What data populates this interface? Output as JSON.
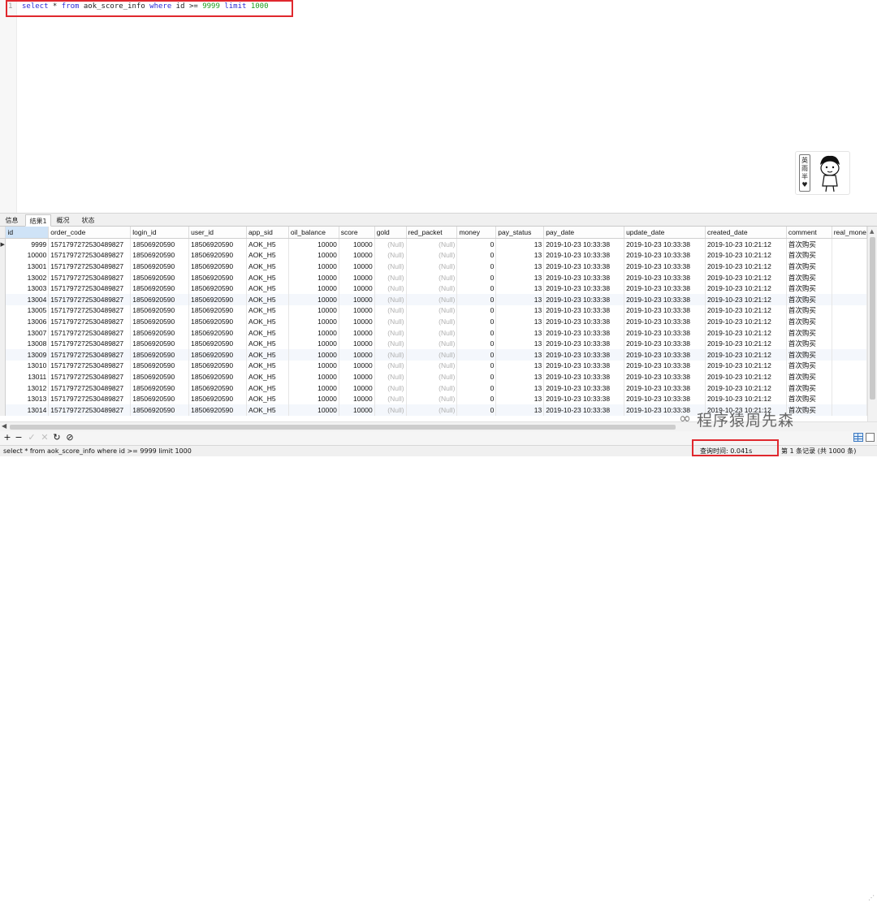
{
  "editor": {
    "line_number": "1",
    "sql": {
      "t1": "select",
      "t2": " * ",
      "t3": "from",
      "t4": " aok_score_info ",
      "t5": "where",
      "t6": " id >= ",
      "t7": "9999",
      "t8": " ",
      "t9": "limit",
      "t10": " ",
      "t11": "1000"
    }
  },
  "avatar": {
    "tag": [
      "英",
      "雨",
      "半"
    ]
  },
  "tabs": [
    {
      "label": "信息"
    },
    {
      "label": "结果1"
    },
    {
      "label": "概况"
    },
    {
      "label": "状态"
    }
  ],
  "active_tab": 1,
  "grid": {
    "columns": [
      "id",
      "order_code",
      "login_id",
      "user_id",
      "app_sid",
      "oil_balance",
      "score",
      "gold",
      "red_packet",
      "money",
      "pay_status",
      "pay_date",
      "update_date",
      "created_date",
      "comment",
      "real_mone"
    ],
    "rows": [
      [
        "9999",
        "1571797272530489827",
        "18506920590",
        "18506920590",
        "AOK_H5",
        "10000",
        "10000",
        "(Null)",
        "(Null)",
        "0",
        "13",
        "2019-10-23 10:33:38",
        "2019-10-23 10:33:38",
        "2019-10-23 10:21:12",
        "首次购买",
        ""
      ],
      [
        "10000",
        "1571797272530489827",
        "18506920590",
        "18506920590",
        "AOK_H5",
        "10000",
        "10000",
        "(Null)",
        "(Null)",
        "0",
        "13",
        "2019-10-23 10:33:38",
        "2019-10-23 10:33:38",
        "2019-10-23 10:21:12",
        "首次购买",
        ""
      ],
      [
        "13001",
        "1571797272530489827",
        "18506920590",
        "18506920590",
        "AOK_H5",
        "10000",
        "10000",
        "(Null)",
        "(Null)",
        "0",
        "13",
        "2019-10-23 10:33:38",
        "2019-10-23 10:33:38",
        "2019-10-23 10:21:12",
        "首次购买",
        ""
      ],
      [
        "13002",
        "1571797272530489827",
        "18506920590",
        "18506920590",
        "AOK_H5",
        "10000",
        "10000",
        "(Null)",
        "(Null)",
        "0",
        "13",
        "2019-10-23 10:33:38",
        "2019-10-23 10:33:38",
        "2019-10-23 10:21:12",
        "首次购买",
        ""
      ],
      [
        "13003",
        "1571797272530489827",
        "18506920590",
        "18506920590",
        "AOK_H5",
        "10000",
        "10000",
        "(Null)",
        "(Null)",
        "0",
        "13",
        "2019-10-23 10:33:38",
        "2019-10-23 10:33:38",
        "2019-10-23 10:21:12",
        "首次购买",
        ""
      ],
      [
        "13004",
        "1571797272530489827",
        "18506920590",
        "18506920590",
        "AOK_H5",
        "10000",
        "10000",
        "(Null)",
        "(Null)",
        "0",
        "13",
        "2019-10-23 10:33:38",
        "2019-10-23 10:33:38",
        "2019-10-23 10:21:12",
        "首次购买",
        ""
      ],
      [
        "13005",
        "1571797272530489827",
        "18506920590",
        "18506920590",
        "AOK_H5",
        "10000",
        "10000",
        "(Null)",
        "(Null)",
        "0",
        "13",
        "2019-10-23 10:33:38",
        "2019-10-23 10:33:38",
        "2019-10-23 10:21:12",
        "首次购买",
        ""
      ],
      [
        "13006",
        "1571797272530489827",
        "18506920590",
        "18506920590",
        "AOK_H5",
        "10000",
        "10000",
        "(Null)",
        "(Null)",
        "0",
        "13",
        "2019-10-23 10:33:38",
        "2019-10-23 10:33:38",
        "2019-10-23 10:21:12",
        "首次购买",
        ""
      ],
      [
        "13007",
        "1571797272530489827",
        "18506920590",
        "18506920590",
        "AOK_H5",
        "10000",
        "10000",
        "(Null)",
        "(Null)",
        "0",
        "13",
        "2019-10-23 10:33:38",
        "2019-10-23 10:33:38",
        "2019-10-23 10:21:12",
        "首次购买",
        ""
      ],
      [
        "13008",
        "1571797272530489827",
        "18506920590",
        "18506920590",
        "AOK_H5",
        "10000",
        "10000",
        "(Null)",
        "(Null)",
        "0",
        "13",
        "2019-10-23 10:33:38",
        "2019-10-23 10:33:38",
        "2019-10-23 10:21:12",
        "首次购买",
        ""
      ],
      [
        "13009",
        "1571797272530489827",
        "18506920590",
        "18506920590",
        "AOK_H5",
        "10000",
        "10000",
        "(Null)",
        "(Null)",
        "0",
        "13",
        "2019-10-23 10:33:38",
        "2019-10-23 10:33:38",
        "2019-10-23 10:21:12",
        "首次购买",
        ""
      ],
      [
        "13010",
        "1571797272530489827",
        "18506920590",
        "18506920590",
        "AOK_H5",
        "10000",
        "10000",
        "(Null)",
        "(Null)",
        "0",
        "13",
        "2019-10-23 10:33:38",
        "2019-10-23 10:33:38",
        "2019-10-23 10:21:12",
        "首次购买",
        ""
      ],
      [
        "13011",
        "1571797272530489827",
        "18506920590",
        "18506920590",
        "AOK_H5",
        "10000",
        "10000",
        "(Null)",
        "(Null)",
        "0",
        "13",
        "2019-10-23 10:33:38",
        "2019-10-23 10:33:38",
        "2019-10-23 10:21:12",
        "首次购买",
        ""
      ],
      [
        "13012",
        "1571797272530489827",
        "18506920590",
        "18506920590",
        "AOK_H5",
        "10000",
        "10000",
        "(Null)",
        "(Null)",
        "0",
        "13",
        "2019-10-23 10:33:38",
        "2019-10-23 10:33:38",
        "2019-10-23 10:21:12",
        "首次购买",
        ""
      ],
      [
        "13013",
        "1571797272530489827",
        "18506920590",
        "18506920590",
        "AOK_H5",
        "10000",
        "10000",
        "(Null)",
        "(Null)",
        "0",
        "13",
        "2019-10-23 10:33:38",
        "2019-10-23 10:33:38",
        "2019-10-23 10:21:12",
        "首次购买",
        ""
      ],
      [
        "13014",
        "1571797272530489827",
        "18506920590",
        "18506920590",
        "AOK_H5",
        "10000",
        "10000",
        "(Null)",
        "(Null)",
        "0",
        "13",
        "2019-10-23 10:33:38",
        "2019-10-23 10:33:38",
        "2019-10-23 10:21:12",
        "首次购买",
        ""
      ]
    ]
  },
  "toolbar": {
    "buttons": [
      {
        "name": "add-record-button",
        "glyph": "+",
        "icon": "plus-icon",
        "enabled": true
      },
      {
        "name": "delete-record-button",
        "glyph": "−",
        "icon": "minus-icon",
        "enabled": true
      },
      {
        "name": "apply-button",
        "glyph": "✓",
        "icon": "check-icon",
        "enabled": false
      },
      {
        "name": "discard-button",
        "glyph": "✕",
        "icon": "close-icon",
        "enabled": false
      },
      {
        "name": "refresh-button",
        "glyph": "↻",
        "icon": "refresh-icon",
        "enabled": true
      },
      {
        "name": "stop-button",
        "glyph": "⊘",
        "icon": "stop-icon",
        "enabled": true
      }
    ]
  },
  "watermark": {
    "text": "程序猿周先森"
  },
  "status": {
    "sql": "select * from aok_score_info where id >= 9999 limit 1000",
    "query_time": "查询时间: 0.041s",
    "records": "第 1 条记录 (共 1000 条)"
  },
  "colors": {
    "keyword": "#2b2bd6",
    "number": "#1a9b1a",
    "highlight_box": "#e0282e",
    "row_alt": "#f4f7fc"
  }
}
